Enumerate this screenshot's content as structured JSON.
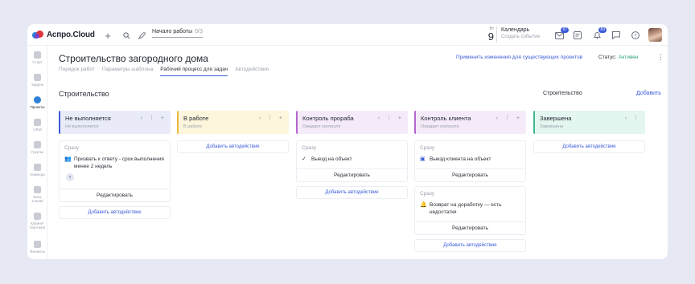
{
  "app": {
    "logo_text": "Аспро.Cloud",
    "work_start_label": "Начало работы",
    "work_start_count": "0/3",
    "day_of_week": "Вт",
    "day_number": "9",
    "calendar_title": "Календарь",
    "calendar_sub": "Создать событие",
    "badges": {
      "messages": "67",
      "notifications": "83"
    }
  },
  "sidebar": {
    "items": [
      {
        "label": "Старт"
      },
      {
        "label": "Задачи"
      },
      {
        "label": "Проекты"
      },
      {
        "label": "CRM"
      },
      {
        "label": "Группы"
      },
      {
        "label": "Команда"
      },
      {
        "label": "База знаний"
      },
      {
        "label": "Кабинет партнера"
      },
      {
        "label": "Финансы"
      }
    ]
  },
  "page": {
    "title": "Строительство загородного дома",
    "tabs": [
      {
        "label": "Порядок работ"
      },
      {
        "label": "Параметры шаблона"
      },
      {
        "label": "Рабочий процесс для задач"
      },
      {
        "label": "Автодействия"
      }
    ],
    "apply_link": "Применить изменения для существующих проектов",
    "status_label": "Статус:",
    "status_value": "Активен",
    "section_title": "Строительство",
    "section_right": "Строительство",
    "add_label": "Добавить"
  },
  "colors": {
    "accent": "#3a5bd9",
    "status_active": "#2aa37c",
    "col_not_done": "#e9ecf8",
    "col_in_work": "#fdf5dc",
    "col_foreman": "#f5ebf8",
    "col_client": "#f5ebf8",
    "col_done": "#e3f6f0"
  },
  "columns": [
    {
      "title": "Не выполняется",
      "subtitle": "Не выполняется",
      "card_when": "Сразу",
      "card_action": "Призвать к ответу - срок выполнения менее 2 недель",
      "edit": "Редактировать",
      "add_auto": "Добавить автодействие"
    },
    {
      "title": "В работе",
      "subtitle": "В работе",
      "add_auto": "Добавить автодействие"
    },
    {
      "title": "Контроль прораба",
      "subtitle": "Ожидает контроля",
      "card_when": "Сразу",
      "card_action": "Выезд на объект",
      "edit": "Редактировать",
      "add_auto": "Добавить автодействие"
    },
    {
      "title": "Контроль клиента",
      "subtitle": "Ожидает контроля",
      "card_when": "Сразу",
      "card_action": "Выезд клиента на объект",
      "edit": "Редактировать",
      "card2_when": "Сразу",
      "card2_action": "Возврат на доработку — есть недостатки",
      "edit2": "Редактировать",
      "add_auto": "Добавить автодействие"
    },
    {
      "title": "Завершена",
      "subtitle": "Завершена",
      "add_auto": "Добавить автодействие"
    }
  ]
}
